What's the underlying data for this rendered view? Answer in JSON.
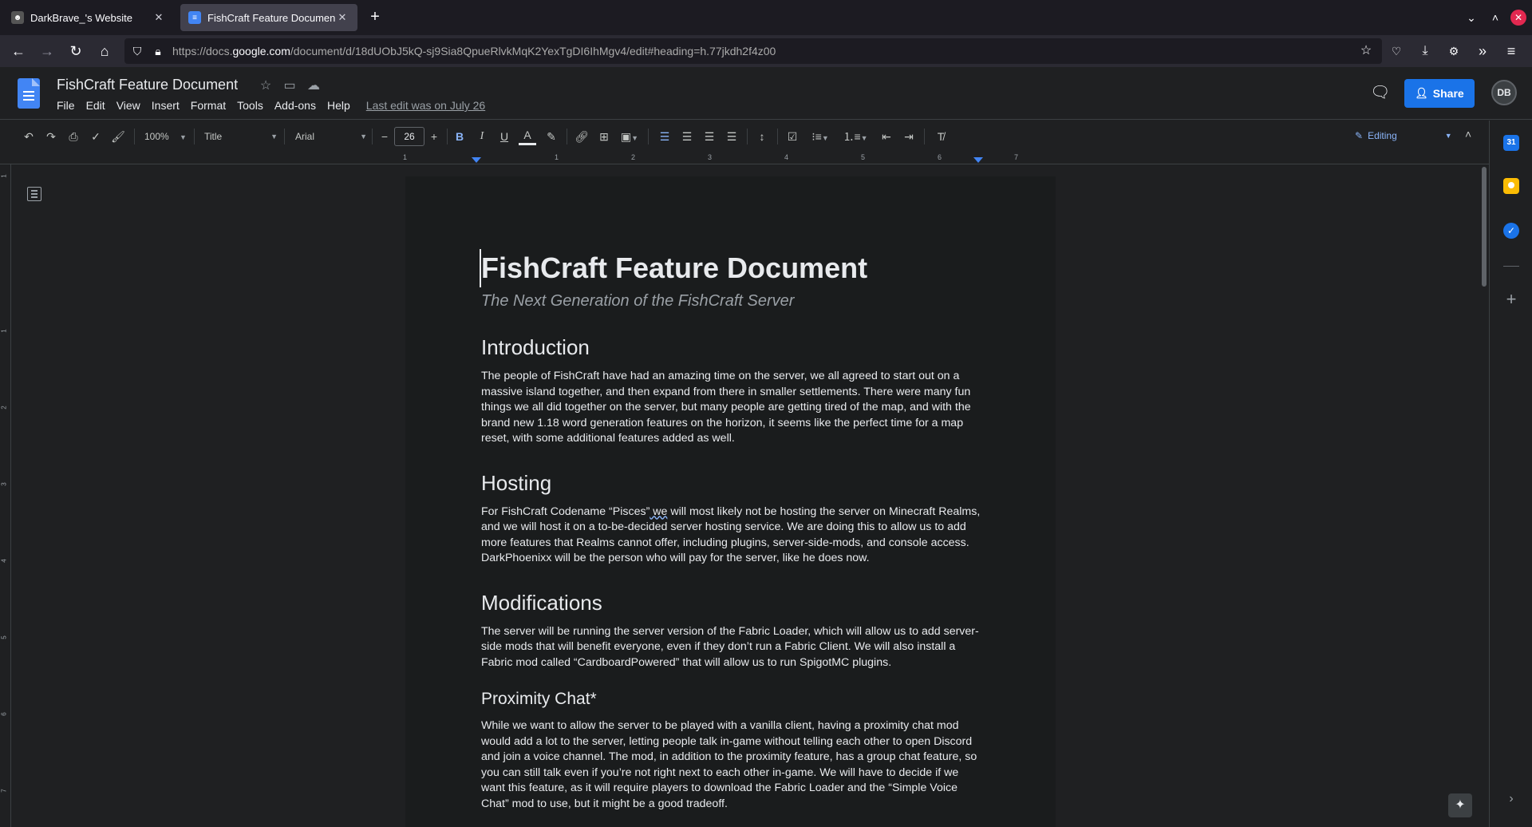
{
  "browser": {
    "tabs": [
      {
        "title": "DarkBrave_'s Website",
        "active": false
      },
      {
        "title": "FishCraft Feature Document",
        "active": true
      }
    ],
    "url_prefix": "https://docs.",
    "url_host": "google.com",
    "url_path": "/document/d/18dUObJ5kQ-sj9Sia8QpueRlvkMqK2YexTgDI6IhMgv4/edit#heading=h.77jkdh2f4z00"
  },
  "docs": {
    "title": "FishCraft Feature Document",
    "menu": [
      "File",
      "Edit",
      "View",
      "Insert",
      "Format",
      "Tools",
      "Add-ons",
      "Help"
    ],
    "last_edit": "Last edit was on July 26",
    "share_label": "Share",
    "avatar_initials": "DB"
  },
  "toolbar": {
    "zoom": "100%",
    "style": "Title",
    "font": "Arial",
    "font_size": "26",
    "mode": "Editing"
  },
  "ruler": {
    "numbers": [
      "1",
      "1",
      "2",
      "3",
      "4",
      "5",
      "6",
      "7"
    ],
    "vnumbers": [
      "1",
      "1",
      "2",
      "3",
      "4",
      "5",
      "6",
      "7"
    ]
  },
  "document": {
    "title": "FishCraft Feature Document",
    "subtitle": "The Next Generation of the FishCraft Server",
    "intro_heading": "Introduction",
    "intro_text": "The people of FishCraft have had an amazing time on the server, we all agreed to start out on a massive island together, and then expand from there in smaller settlements. There were many fun things we all did together on the server, but many people are getting tired of the map, and with the brand new 1.18 word generation features on the horizon, it seems like the perfect time for a map reset, with some additional features added as well.",
    "hosting_heading": "Hosting",
    "hosting_text_a": "For FishCraft Codename “Pisces”",
    "hosting_text_we": " we",
    "hosting_text_b": " will most likely not be hosting the server on Minecraft Realms, and we will host it on a to-be-decided server hosting service. We are doing this to allow us to add more features that Realms cannot offer, including plugins, server-side-mods, and console access. DarkPhoenixx will be the person who will pay for the server, like he does now.",
    "mods_heading": "Modifications",
    "mods_text": "The server will be running the server version of the Fabric Loader, which will allow us to add server-side mods that will benefit everyone, even if they don’t run a Fabric Client. We will also install a Fabric mod called “CardboardPowered” that will allow us to run SpigotMC plugins.",
    "prox_heading": "Proximity Chat*",
    "prox_text": "While we want to allow the server to be played with a vanilla client, having a proximity chat mod would add a lot to the server, letting people talk in-game without telling each other to open Discord and join a voice channel. The mod, in addition to the proximity feature, has a group chat feature, so you can still talk even if you’re not right next to each other in-game. We will have to decide if we want this feature, as it will require players to download the Fabric Loader and the “Simple Voice Chat” mod to use, but it might be a good tradeoff."
  },
  "colors": {
    "accent": "#1a73e8",
    "page_bg": "#1a1c1d",
    "chrome_bg": "#1f2022"
  }
}
